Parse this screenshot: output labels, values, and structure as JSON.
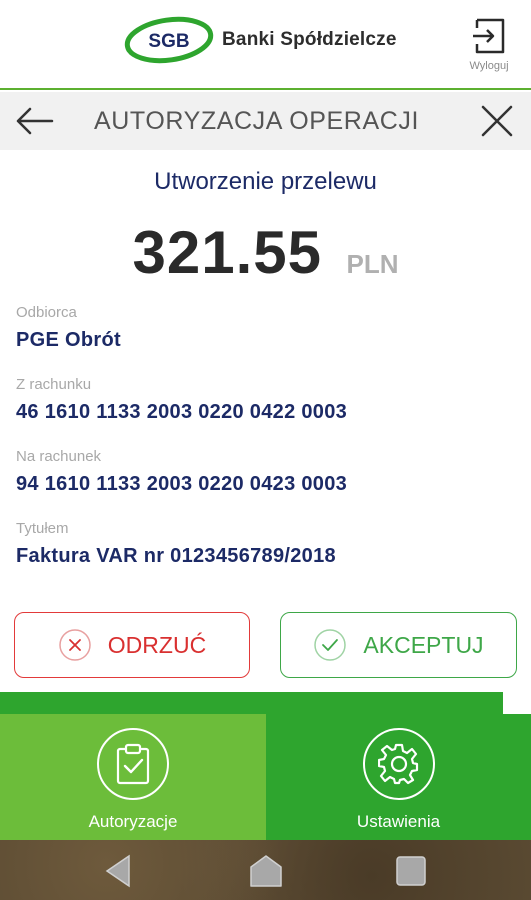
{
  "header": {
    "logo_mark_text": "SGB",
    "brand_name": "Banki Spółdzielcze",
    "logout_label": "Wyloguj"
  },
  "titlebar": {
    "title": "AUTORYZACJA OPERACJI"
  },
  "operation": {
    "title": "Utworzenie przelewu",
    "amount": "321.55",
    "currency": "PLN"
  },
  "fields": [
    {
      "label": "Odbiorca",
      "value": "PGE Obrót"
    },
    {
      "label": "Z rachunku",
      "value": "46 1610 1133 2003 0220 0422 0003"
    },
    {
      "label": "Na rachunek",
      "value": "94 1610 1133 2003 0220 0423 0003"
    },
    {
      "label": "Tytułem",
      "value": "Faktura VAR nr 0123456789/2018"
    }
  ],
  "actions": {
    "reject_label": "ODRZUĆ",
    "accept_label": "AKCEPTUJ"
  },
  "nav": {
    "authorizations_label": "Autoryzacje",
    "settings_label": "Ustawienia"
  },
  "colors": {
    "brand_green": "#2ea52e",
    "light_green": "#6cbd3a",
    "navy_text": "#1c2a66",
    "reject_red": "#e23a3a",
    "accept_green": "#3ea748"
  },
  "icons": {
    "logout": "logout-icon",
    "back": "arrow-left-icon",
    "close": "close-icon",
    "reject": "x-circle-icon",
    "accept": "check-circle-icon",
    "authorizations": "clipboard-check-icon",
    "settings": "gear-icon"
  }
}
